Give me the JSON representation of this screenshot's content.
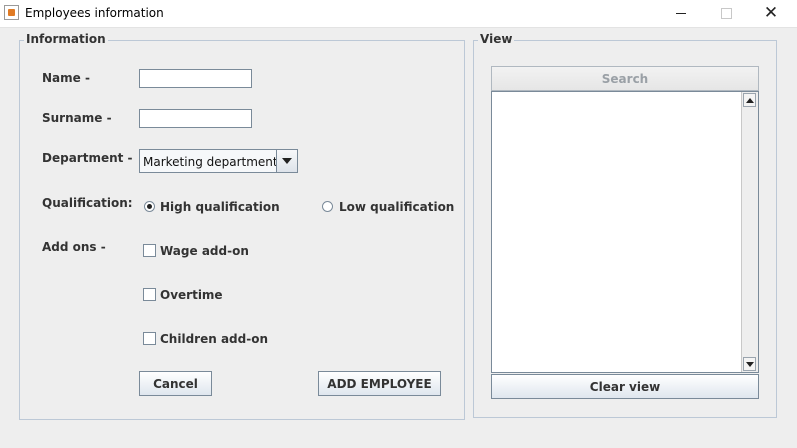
{
  "window": {
    "title": "Employees information"
  },
  "info": {
    "title": "Information",
    "name_label": "Name -",
    "name_value": "",
    "surname_label": "Surname -",
    "surname_value": "",
    "department_label": "Department -",
    "department_selected": "Marketing department",
    "qualification_label": "Qualification:",
    "qual_high": "High qualification",
    "qual_low": "Low qualification",
    "addons_label": "Add ons -",
    "addon_wage": "Wage add-on",
    "addon_overtime": "Overtime",
    "addon_children": "Children add-on",
    "cancel_label": "Cancel",
    "add_label": "ADD EMPLOYEE"
  },
  "view": {
    "title": "View",
    "search_label": "Search",
    "output_text": "",
    "clear_label": "Clear view"
  }
}
